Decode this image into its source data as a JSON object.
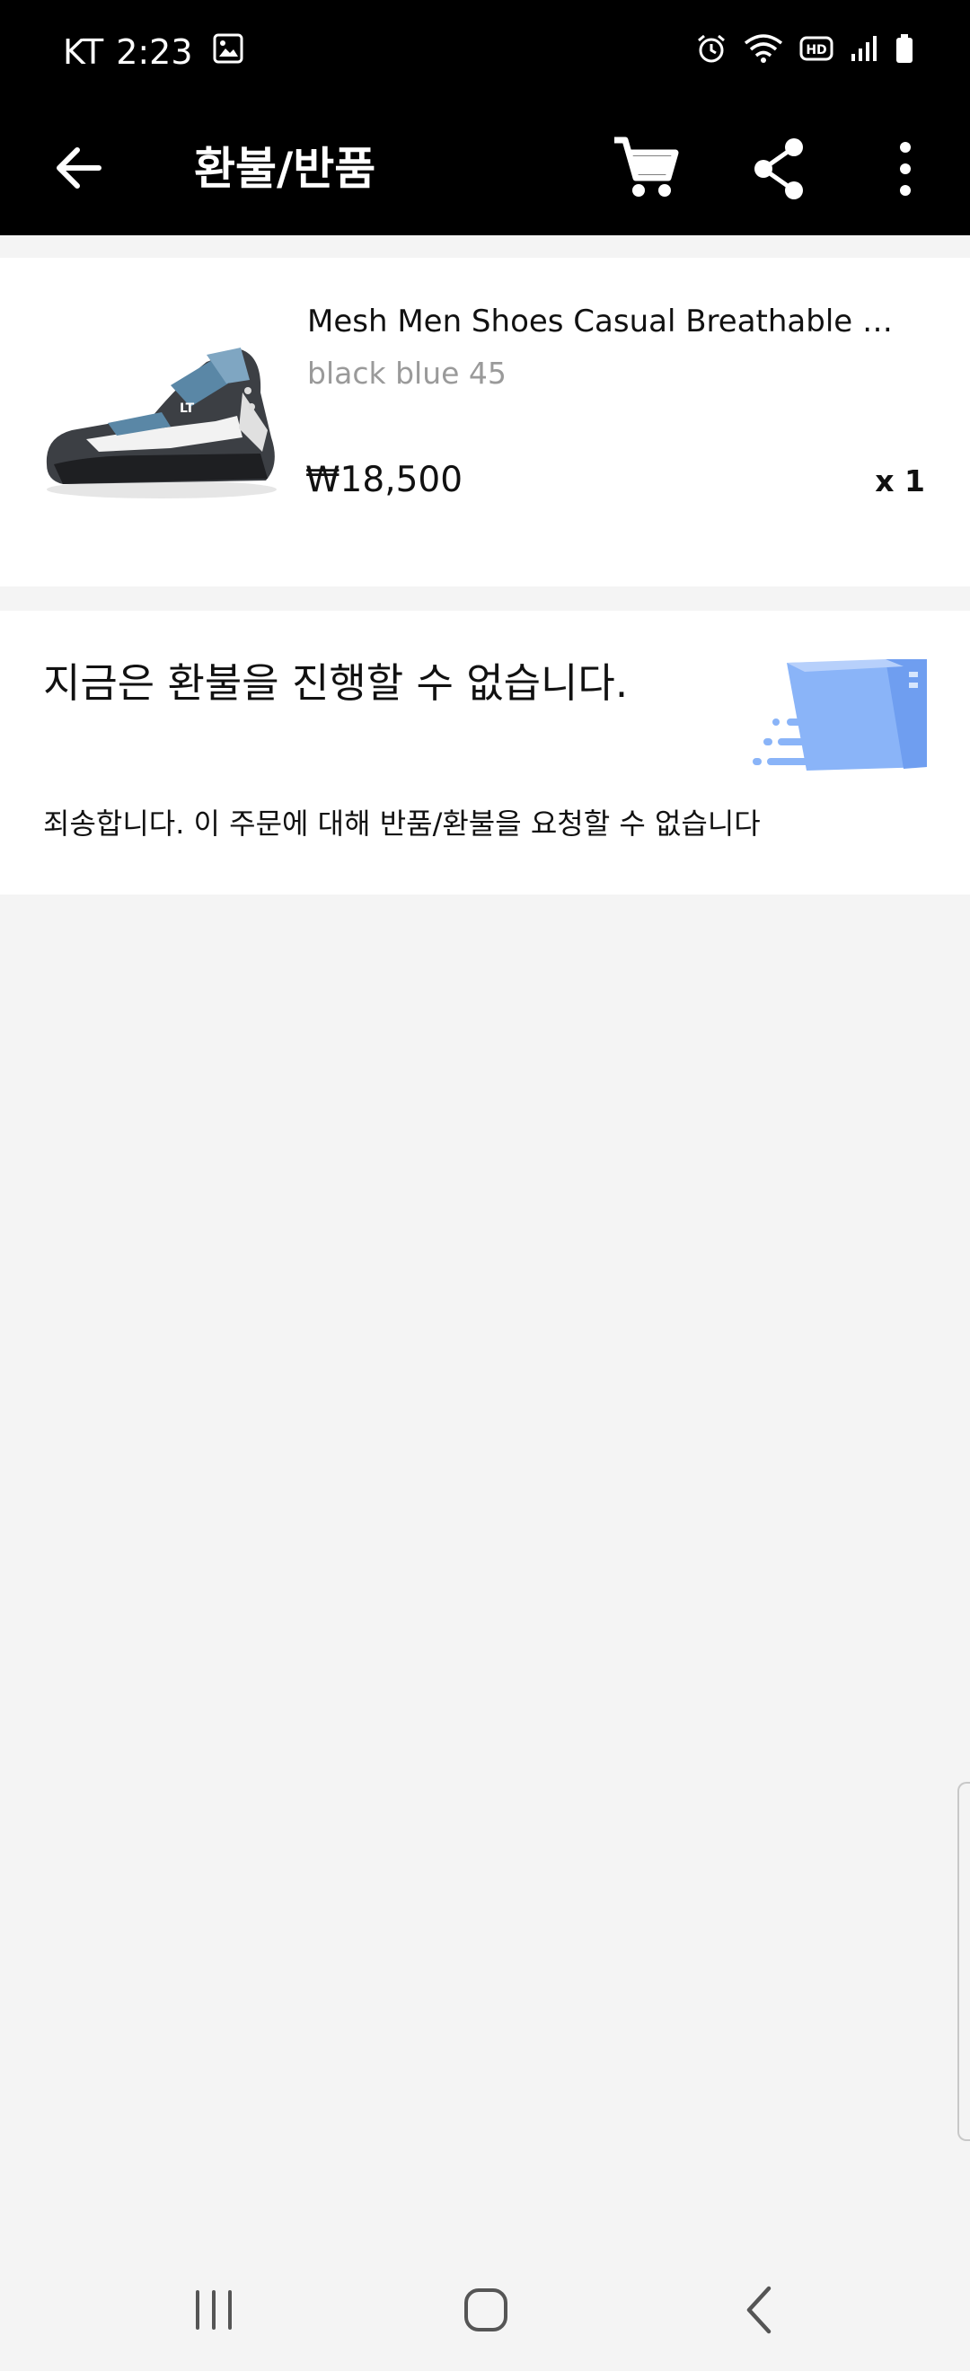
{
  "status_bar": {
    "carrier": "KT",
    "time": "2:23",
    "icons": [
      "gallery-icon",
      "alarm-icon",
      "wifi-icon",
      "hd-icon",
      "signal-icon",
      "battery-icon"
    ]
  },
  "app_bar": {
    "title": "환불/반품",
    "icons": [
      "back-arrow-icon",
      "cart-icon",
      "share-icon",
      "more-vertical-icon"
    ]
  },
  "order_item": {
    "name": "Mesh Men Shoes Casual Breathable Me...",
    "variant": "black blue 45",
    "price": "₩18,500",
    "quantity": "x 1"
  },
  "notice": {
    "title": "지금은 환불을 진행할 수 없습니다.",
    "message": "죄송합니다. 이 주문에 대해 반품/환불을 요청할 수 없습니다",
    "illustration": "box-icon"
  },
  "nav_bar": {
    "icons": [
      "recents-icon",
      "home-icon",
      "back-icon"
    ]
  },
  "colors": {
    "header_bg": "#000000",
    "page_bg": "#f4f4f4",
    "card_bg": "#ffffff",
    "muted_text": "#9a9a9a",
    "illustration_blue": "#8ab4f8"
  }
}
